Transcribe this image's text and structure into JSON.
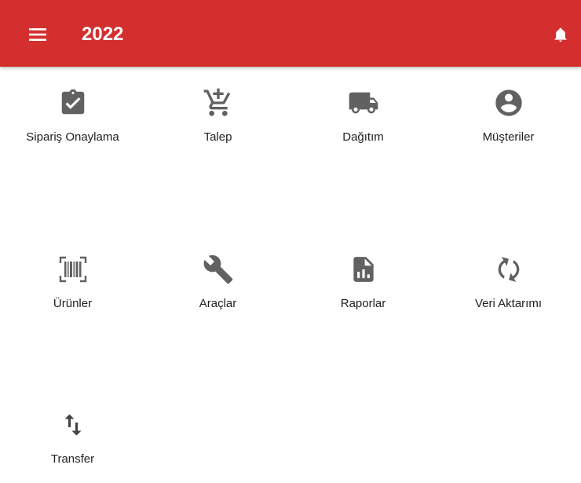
{
  "appbar": {
    "title": "2022",
    "menu_icon": "hamburger-menu-icon",
    "notification_icon": "bell-icon",
    "color": "#d32f2f"
  },
  "menu": {
    "icon_color": "#616161",
    "items": [
      {
        "label": "Sipariş Onaylama",
        "icon": "clipboard-check-icon"
      },
      {
        "label": "Talep",
        "icon": "cart-plus-icon"
      },
      {
        "label": "Dağıtım",
        "icon": "truck-icon"
      },
      {
        "label": "Müşteriler",
        "icon": "account-circle-icon"
      },
      {
        "label": "Ürünler",
        "icon": "barcode-scan-icon"
      },
      {
        "label": "Araçlar",
        "icon": "wrench-icon"
      },
      {
        "label": "Raporlar",
        "icon": "file-chart-icon"
      },
      {
        "label": "Veri Aktarımı",
        "icon": "sync-icon"
      },
      {
        "label": "Transfer",
        "icon": "swap-vertical-icon"
      }
    ]
  }
}
